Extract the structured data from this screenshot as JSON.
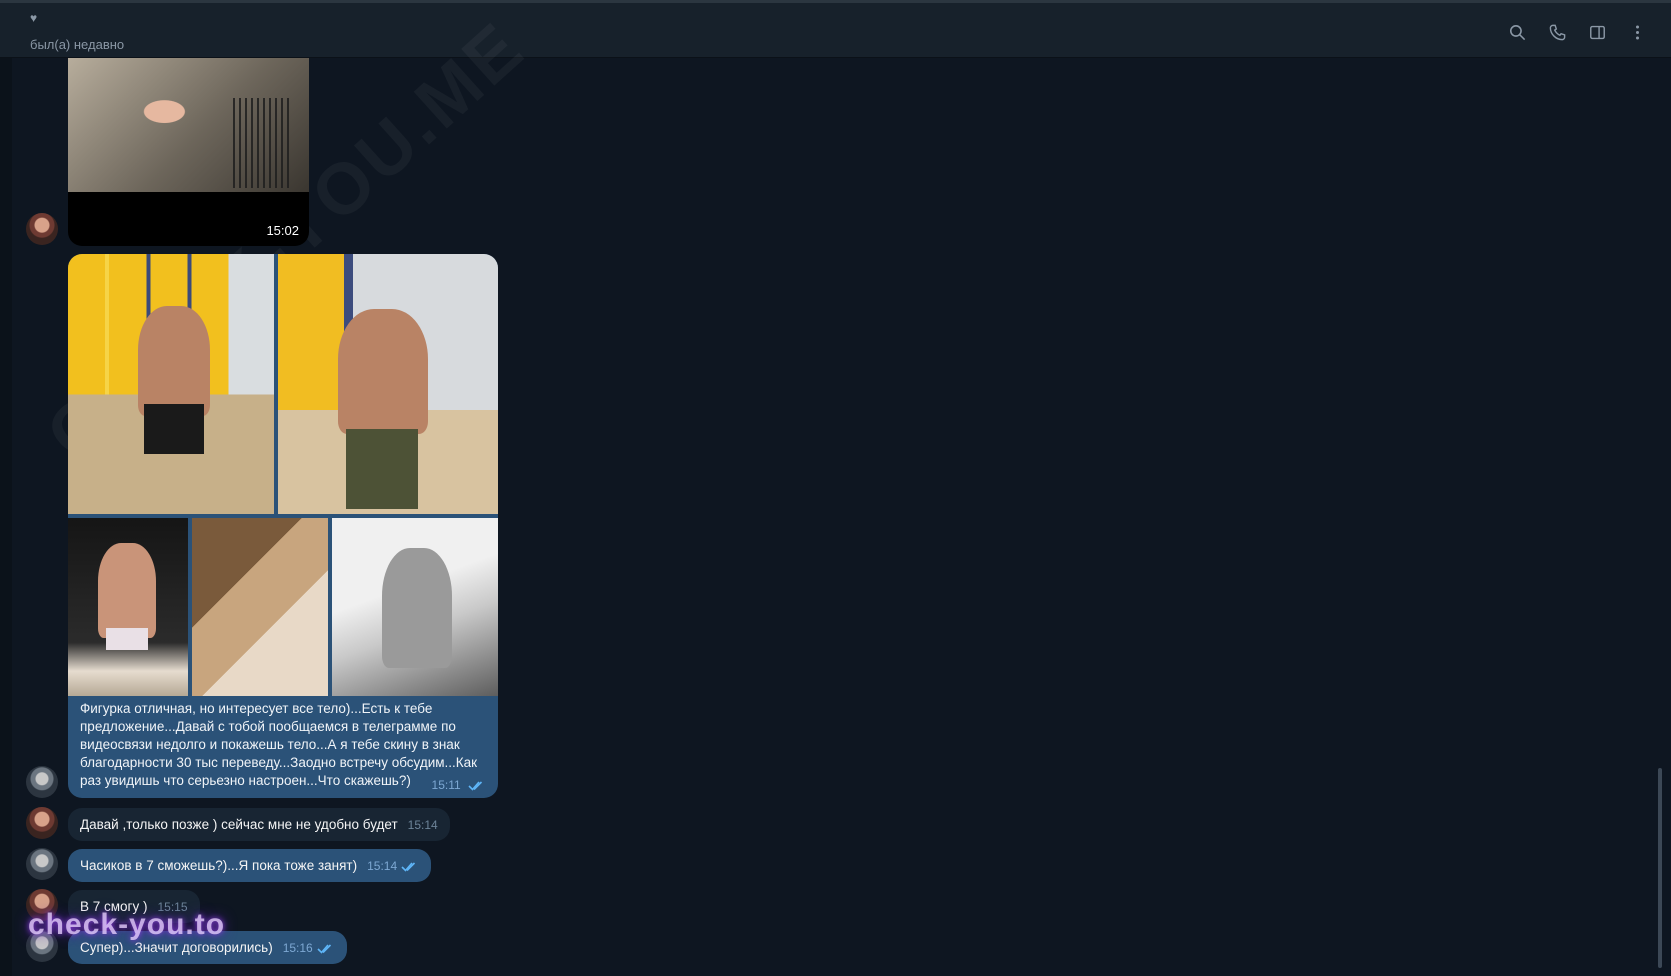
{
  "header": {
    "status": "был(а) недавно",
    "icons": [
      "search-icon",
      "phone-icon",
      "sidebar-icon",
      "more-vertical-icon"
    ]
  },
  "messages": [
    {
      "id": "m1",
      "direction": "in",
      "type": "media",
      "time": "15:02"
    },
    {
      "id": "m2",
      "direction": "out",
      "type": "album",
      "photos": 5,
      "text": "Фигурка отличная, но интересует все тело)...Есть к тебе предложение...Давай с тобой пообщаемся в  телеграмме  по видеосвязи недолго и покажешь тело...А я тебе скину в знак благодарности 30 тыс переведу...Заодно встречу обсудим...Как раз увидишь что серьезно настроен...Что скажешь?)",
      "time": "15:11",
      "read": true
    },
    {
      "id": "m3",
      "direction": "in",
      "text": "Давай ,только позже ) сейчас мне не удобно будет",
      "time": "15:14"
    },
    {
      "id": "m4",
      "direction": "out",
      "text": "Часиков в 7 сможешь?)...Я пока тоже занят)",
      "time": "15:14",
      "read": true
    },
    {
      "id": "m5",
      "direction": "in",
      "text": "В 7 смогу )",
      "time": "15:15"
    },
    {
      "id": "m6",
      "direction": "out",
      "text": "Супер)...Значит договорились)",
      "time": "15:16",
      "read": true
    }
  ],
  "watermarks": {
    "diagonal": "CHECK-YOU.ME",
    "bottom": "check-you.to"
  },
  "colors": {
    "background": "#0e1621",
    "incoming": "#182533",
    "outgoing": "#2b5278",
    "accent": "#5eb5f7"
  }
}
